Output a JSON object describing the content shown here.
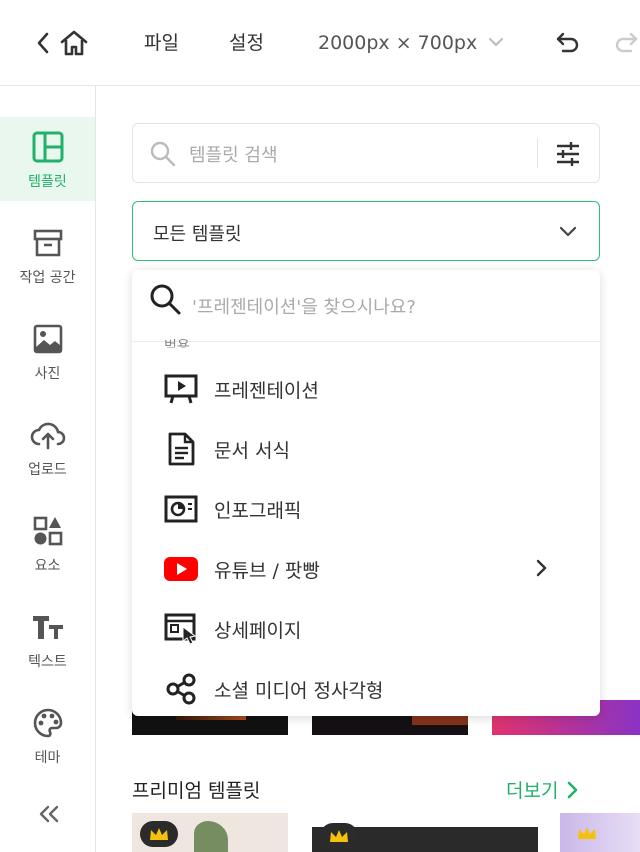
{
  "topbar": {
    "menu_file": "파일",
    "menu_settings": "설정",
    "canvas_size": "2000px × 700px"
  },
  "sidebar": {
    "items": [
      {
        "label": "템플릿",
        "icon": "template-icon",
        "active": true
      },
      {
        "label": "작업 공간",
        "icon": "archive-icon"
      },
      {
        "label": "사진",
        "icon": "photo-icon"
      },
      {
        "label": "업로드",
        "icon": "upload-cloud-icon"
      },
      {
        "label": "요소",
        "icon": "shapes-icon"
      },
      {
        "label": "텍스트",
        "icon": "text-icon"
      },
      {
        "label": "테마",
        "icon": "palette-icon"
      }
    ],
    "collapse_icon": "double-chevron-left-icon"
  },
  "main": {
    "search_placeholder": "템플릿 검색",
    "category_select_value": "모든 템플릿",
    "dropdown": {
      "search_placeholder": "'프레젠테이션'을 찾으시나요?",
      "section_label": "범용",
      "items": [
        {
          "label": "프레젠테이션",
          "icon": "presentation-icon"
        },
        {
          "label": "문서 서식",
          "icon": "document-icon"
        },
        {
          "label": "인포그래픽",
          "icon": "infographic-icon"
        },
        {
          "label": "유튜브 / 팟빵",
          "icon": "youtube-icon",
          "has_submenu": true
        },
        {
          "label": "상세페이지",
          "icon": "detail-page-icon"
        },
        {
          "label": "소셜 미디어 정사각형",
          "icon": "share-icon"
        }
      ]
    },
    "premium_title": "프리미엄 템플릿",
    "more_link": "더보기"
  },
  "colors": {
    "accent": "#20b26b",
    "active_bg": "#e9f7ef",
    "youtube_red": "#ff0000"
  }
}
